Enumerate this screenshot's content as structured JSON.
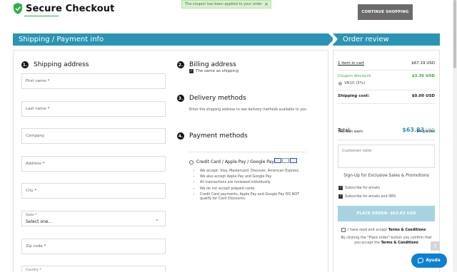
{
  "header": {
    "logo_text": "Secure Checkout",
    "continue_label": "CONTINUE SHOPPING"
  },
  "toast": {
    "message": "The coupon has been applied to your order",
    "close": "×"
  },
  "sections": {
    "left_title": "Shipping / Payment info",
    "right_title": "Order review"
  },
  "shipping": {
    "num": "1.",
    "title": "Shipping address",
    "fields": {
      "first_name": "First name",
      "last_name": "Last name",
      "company": "Company",
      "address": "Address",
      "city": "City",
      "state_label": "State",
      "state_value": "Select one...",
      "zip": "Zip code",
      "country": "Country"
    },
    "required_mark": "*"
  },
  "billing": {
    "num": "2.",
    "title": "Billing address",
    "same_as_shipping": "The same as shipping",
    "same_checked": true
  },
  "delivery": {
    "num": "3.",
    "title": "Delivery methods",
    "note": "Enter the shipping address to see delivery methods available to you"
  },
  "payment": {
    "num": "4.",
    "title": "Payment methods",
    "option_label": "Credit Card / Apple Pay / Google Pay",
    "notes": [
      "We accept: Visa, Mastercard, Discover, American Express.",
      "We also accept Apple Pay and Google Pay",
      "All transactions are reviewed individually.",
      "We do not accept prepaid cards.",
      "Credit Card payments, Apple Pay and Google Pay DO NOT qualify for Cash Discounts."
    ]
  },
  "order": {
    "items_label": "1 item in cart",
    "items_value": "$67.19 USD",
    "coupon_label": "Coupon discount:",
    "coupon_value": "$3.36 USD",
    "coupon_code": "VB10 (5%)",
    "shipping_label": "Shipping cost:",
    "shipping_value": "$0.00 USD",
    "total_label": "Total:",
    "total_amount": "$63.83",
    "total_currency": "USD",
    "earn_label": "You can earn",
    "earn_value": "64 points",
    "note_placeholder": "Customer note:",
    "signup_title": "Sign-Up for Exclusive Sales & Promotions",
    "subscribe_email": "Subscribe for emails",
    "subscribe_sms": "Subscribe for emails and SMS",
    "place_order": "PLACE ORDER: $63.83 USD",
    "terms_prefix": "I have read and accept",
    "terms_link": "Terms & Conditions",
    "disclaimer_prefix": "By clicking the \"Place order\" button you confirm that you accept the",
    "disclaimer_link": "Terms & Conditions"
  },
  "help": {
    "label": "Ayuda"
  },
  "colors": {
    "accent": "#2a94b4",
    "green": "#3fa73b",
    "help": "#0e7fd1"
  }
}
